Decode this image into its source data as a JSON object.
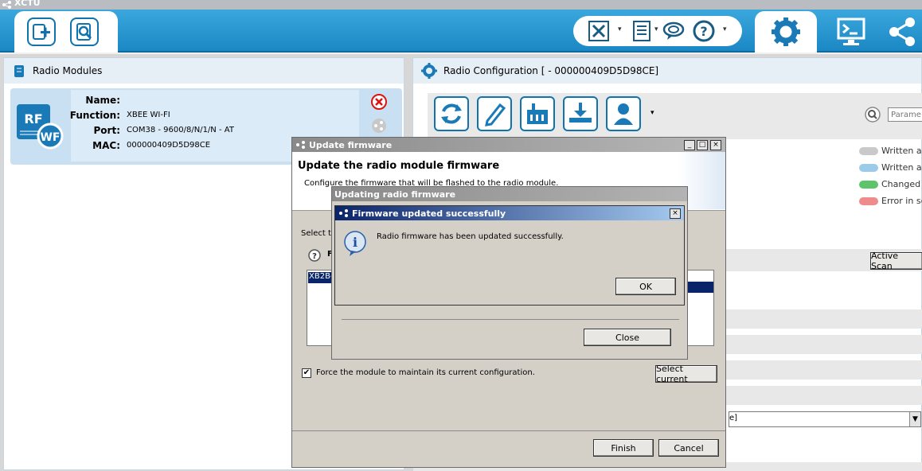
{
  "app": {
    "title": "XCTU"
  },
  "toolbar": {
    "add_module": "add-module",
    "discover": "discover-modules",
    "tools_menu": "tools",
    "frames_menu": "frames-generator",
    "console_menu": "serial-console",
    "help_menu": "help",
    "modes": [
      "configuration",
      "consoles",
      "network"
    ]
  },
  "left_panel": {
    "title": "Radio Modules",
    "module": {
      "badge_rf": "RF",
      "badge_wf": "WF",
      "name_label": "Name:",
      "name_value": "",
      "function_label": "Function:",
      "function_value": "XBEE WI-FI",
      "port_label": "Port:",
      "port_value": "COM38 - 9600/8/N/1/N - AT",
      "mac_label": "MAC:",
      "mac_value": "000000409D5D98CE"
    }
  },
  "right_panel": {
    "title": "Radio Configuration [  - 000000409D5D98CE]",
    "search_placeholder": "Parame",
    "legend": [
      {
        "label": "Written an",
        "color": "#c9c9c9"
      },
      {
        "label": "Written an",
        "color": "#9ccbea"
      },
      {
        "label": "Changed b",
        "color": "#5ec46a"
      },
      {
        "label": "Error in se",
        "color": "#f08b8b"
      }
    ],
    "active_scan": "Active Scan",
    "dropdown_partial": "e]"
  },
  "update_dialog": {
    "title": "Update firmware",
    "heading": "Update the radio module firmware",
    "description": "Configure the firmware that will be flashed to the radio module.",
    "select_prefix": "Select t",
    "help_label": "F",
    "list_item": "XB2B-",
    "force_label": "Force the module to maintain its current configuration.",
    "force_checked": true,
    "select_current": "Select current",
    "finish": "Finish",
    "cancel": "Cancel"
  },
  "progress_dialog": {
    "title": "Updating radio firmware",
    "close": "Close"
  },
  "success_dialog": {
    "title": "Firmware updated successfully",
    "message": "Radio firmware has been updated successfully.",
    "ok": "OK"
  }
}
